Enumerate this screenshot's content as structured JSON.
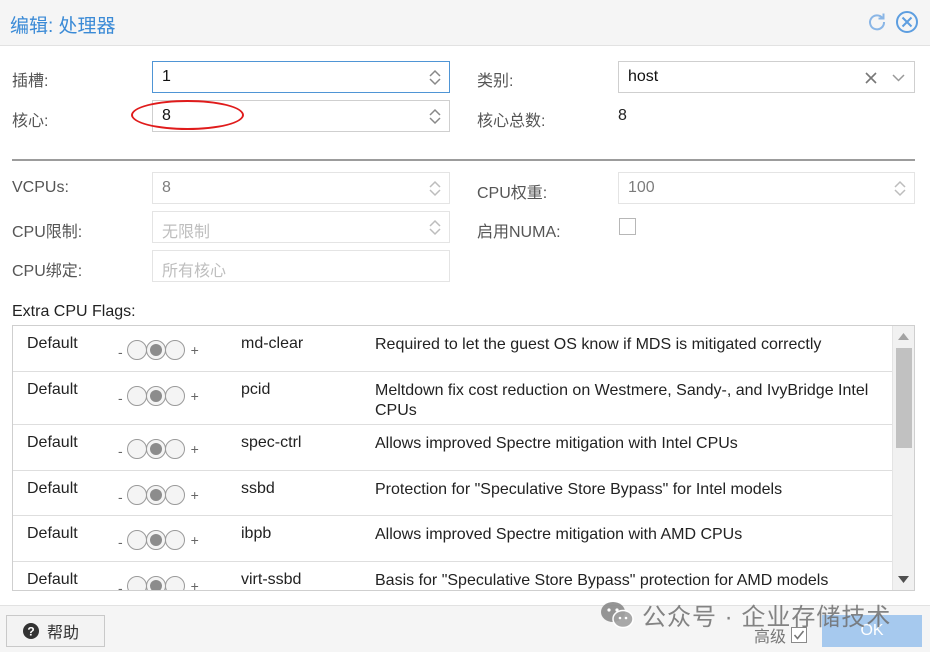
{
  "dialog": {
    "title": "编辑: 处理器"
  },
  "form": {
    "sockets": {
      "label": "插槽:",
      "value": "1"
    },
    "cores": {
      "label": "核心:",
      "value": "8"
    },
    "type": {
      "label": "类别:",
      "value": "host"
    },
    "total_cores": {
      "label": "核心总数:",
      "value": "8"
    },
    "vcpus": {
      "label": "VCPUs:",
      "value": "8"
    },
    "cpu_units": {
      "label": "CPU权重:",
      "value": "100"
    },
    "cpu_limit": {
      "label": "CPU限制:",
      "placeholder": "无限制"
    },
    "numa": {
      "label": "启用NUMA:",
      "checked": false
    },
    "cpu_affinity": {
      "label": "CPU绑定:",
      "placeholder": "所有核心"
    }
  },
  "flags": {
    "title": "Extra CPU Flags:",
    "tri_minus": "-",
    "tri_plus": "+",
    "rows": [
      {
        "state": "Default",
        "name": "md-clear",
        "desc": "Required to let the guest OS know if MDS is mitigated correctly"
      },
      {
        "state": "Default",
        "name": "pcid",
        "desc": "Meltdown fix cost reduction on Westmere, Sandy-, and IvyBridge Intel CPUs"
      },
      {
        "state": "Default",
        "name": "spec-ctrl",
        "desc": "Allows improved Spectre mitigation with Intel CPUs"
      },
      {
        "state": "Default",
        "name": "ssbd",
        "desc": "Protection for \"Speculative Store Bypass\" for Intel models"
      },
      {
        "state": "Default",
        "name": "ibpb",
        "desc": "Allows improved Spectre mitigation with AMD CPUs"
      },
      {
        "state": "Default",
        "name": "virt-ssbd",
        "desc": "Basis for \"Speculative Store Bypass\" protection for AMD models"
      }
    ]
  },
  "footer": {
    "help": "帮助",
    "advanced": "高级",
    "advanced_checked": true,
    "ok": "OK"
  },
  "watermark": {
    "text": "公众号 · 企业存储技术"
  },
  "colors": {
    "title": "#3a8ad6",
    "focus_border": "#4f95d5",
    "ok_button": "#a6c9ee",
    "annotation": "#e01b1b"
  }
}
